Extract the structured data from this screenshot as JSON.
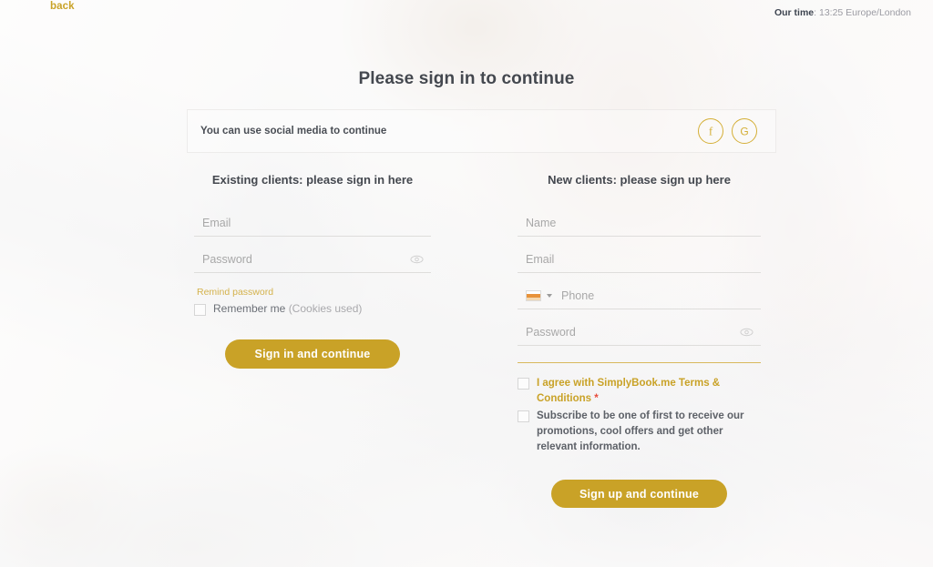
{
  "topbar": {
    "back_label": "back",
    "time_prefix": "Our time",
    "time_separator": ":",
    "time_value": "13:25 Europe/London"
  },
  "page": {
    "title": "Please sign in to continue"
  },
  "social": {
    "label": "You can use social media to continue",
    "buttons": [
      {
        "icon": "facebook-icon",
        "glyph": "f"
      },
      {
        "icon": "google-icon",
        "glyph": "G"
      }
    ]
  },
  "signin": {
    "heading": "Existing clients: please sign in here",
    "email_placeholder": "Email",
    "email_value": "",
    "password_placeholder": "Password",
    "password_value": "",
    "remind_label": "Remind password",
    "remember_label": "Remember me ",
    "remember_muted": "(Cookies used)",
    "submit_label": "Sign in and continue"
  },
  "signup": {
    "heading": "New clients: please sign up here",
    "name_placeholder": "Name",
    "name_value": "",
    "email_placeholder": "Email",
    "email_value": "",
    "phone_placeholder": "Phone",
    "phone_value": "",
    "password_placeholder": "Password",
    "password_value": "",
    "terms_text": "I agree with SimplyBook.me Terms & Conditions ",
    "terms_required_mark": "*",
    "subscribe_text": "Subscribe to be one of first to receive our promotions, cool offers and get other relevant information.",
    "submit_label": "Sign up and continue"
  },
  "colors": {
    "gold": "#c9a227",
    "gold_light": "#d4af37",
    "gold_divider": "#d8b85c",
    "text_dark": "#44484f",
    "text_muted": "#a8a8a8",
    "required_red": "#e74c3c",
    "page_bg": "#f7f6f4"
  }
}
